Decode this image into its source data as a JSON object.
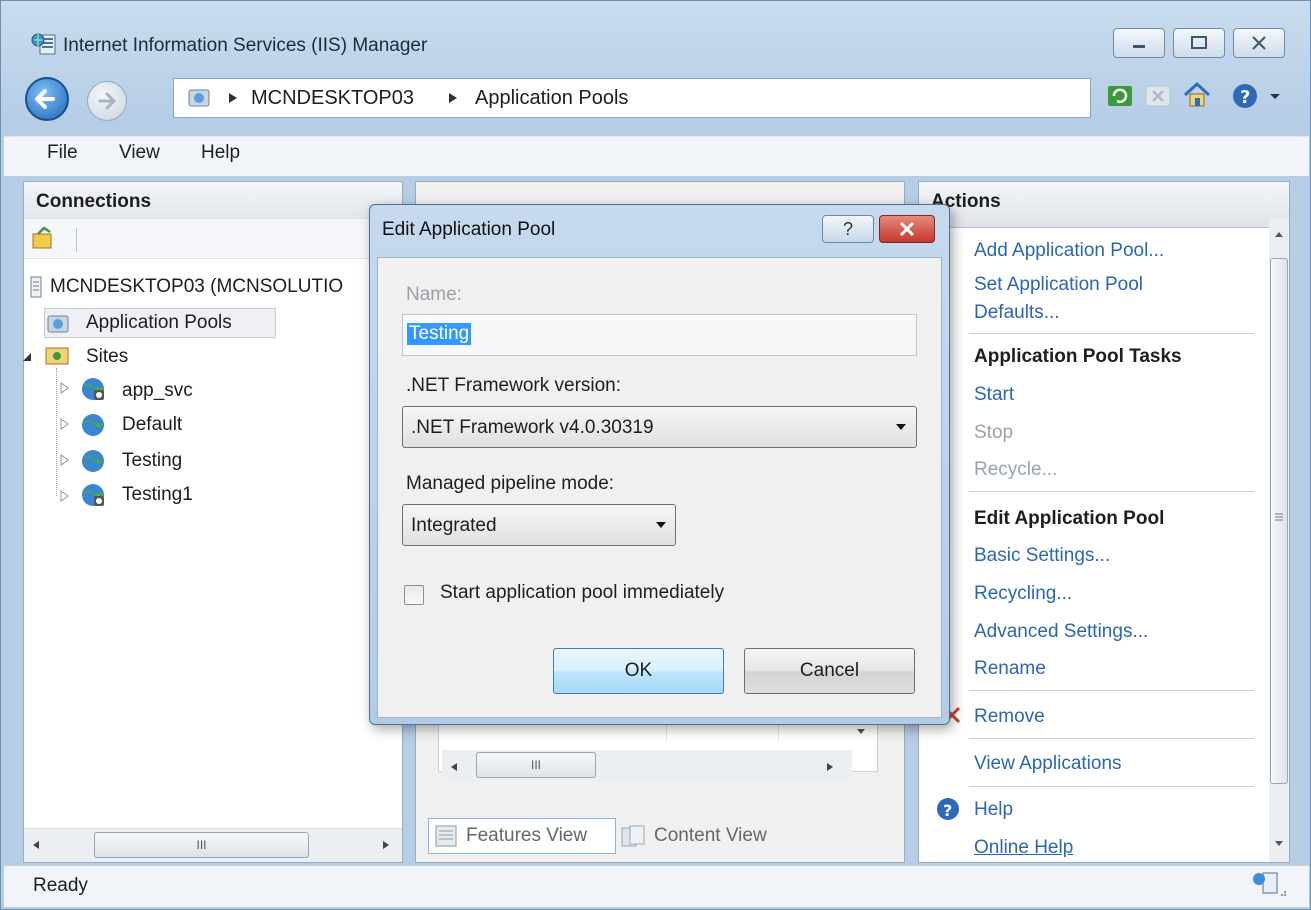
{
  "window": {
    "title": "Internet Information Services (IIS) Manager"
  },
  "address": {
    "crumbs": [
      "MCNDESKTOP03",
      "Application Pools"
    ]
  },
  "menu": [
    "File",
    "View",
    "Help"
  ],
  "connections": {
    "title": "Connections",
    "server": "MCNDESKTOP03 (MCNSOLUTIO",
    "app_pools": "Application Pools",
    "sites": "Sites",
    "site_items": [
      "app_svc",
      "Default",
      "Testing",
      "Testing1"
    ],
    "hscroll_grip": "III"
  },
  "center": {
    "features_view": "Features View",
    "content_view": "Content View",
    "hscroll_grip": "III"
  },
  "actions": {
    "title": "Actions",
    "add_pool": "Add Application Pool...",
    "set_defaults_1": "Set Application Pool",
    "set_defaults_2": "Defaults...",
    "tasks_header": "Application Pool Tasks",
    "start": "Start",
    "stop": "Stop",
    "recycle": "Recycle...",
    "edit_header": "Edit Application Pool",
    "basic_settings": "Basic Settings...",
    "recycling": "Recycling...",
    "advanced_settings": "Advanced Settings...",
    "rename": "Rename",
    "remove": "Remove",
    "view_apps": "View Applications",
    "help": "Help",
    "online_help": "Online Help"
  },
  "status": {
    "text": "Ready"
  },
  "dialog": {
    "title": "Edit Application Pool",
    "name_label": "Name:",
    "name_value": "Testing",
    "framework_label": ".NET Framework version:",
    "framework_value": ".NET Framework v4.0.30319",
    "pipeline_label": "Managed pipeline mode:",
    "pipeline_value": "Integrated",
    "start_checkbox_label": "Start application pool immediately",
    "start_checked": false,
    "ok": "OK",
    "cancel": "Cancel",
    "help_glyph": "?"
  },
  "colors": {
    "link": "#2a67b1",
    "dim": "#9aa3ad",
    "selection": "#3399ff",
    "close_button": "#c9453a"
  }
}
